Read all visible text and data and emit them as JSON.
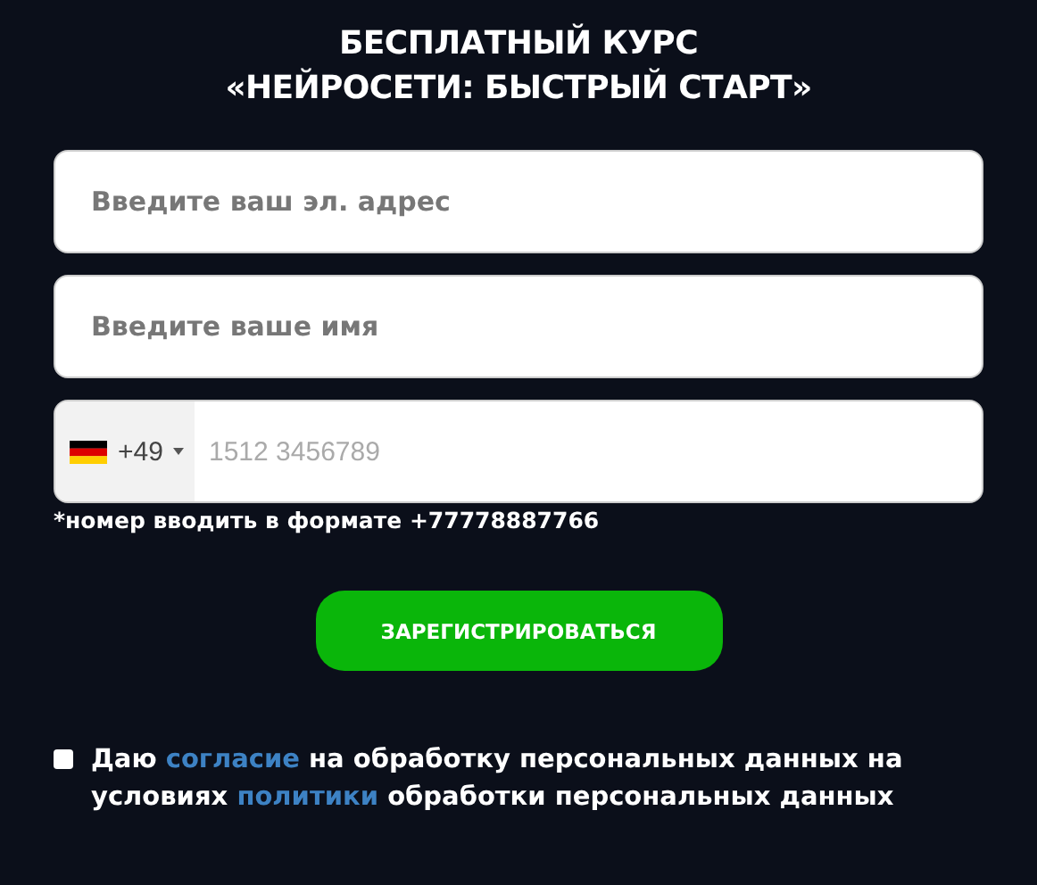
{
  "title": [
    "БЕСПЛАТНЫЙ КУРС",
    "«НЕЙРОСЕТИ: БЫСТРЫЙ СТАРТ»"
  ],
  "fields": [
    {
      "kind": "text",
      "placeholder": "Введите ваш эл. адрес"
    },
    {
      "kind": "text",
      "placeholder": "Введите ваше имя"
    },
    {
      "kind": "phone",
      "code": "+49",
      "placeholder": "1512 3456789"
    }
  ],
  "hint": "*номер вводить в формате +77778887766",
  "button": "ЗАРЕГИСТРИРОВАТЬСЯ",
  "consent": {
    "checked": false,
    "parts": [
      {
        "kind": "text",
        "text": "Даю "
      },
      {
        "kind": "link",
        "text": "согласие"
      },
      {
        "kind": "text",
        "text": " на обработку персональных данных на условиях "
      },
      {
        "kind": "link",
        "text": "политики"
      },
      {
        "kind": "text",
        "text": " обработки персональных данных"
      }
    ]
  }
}
